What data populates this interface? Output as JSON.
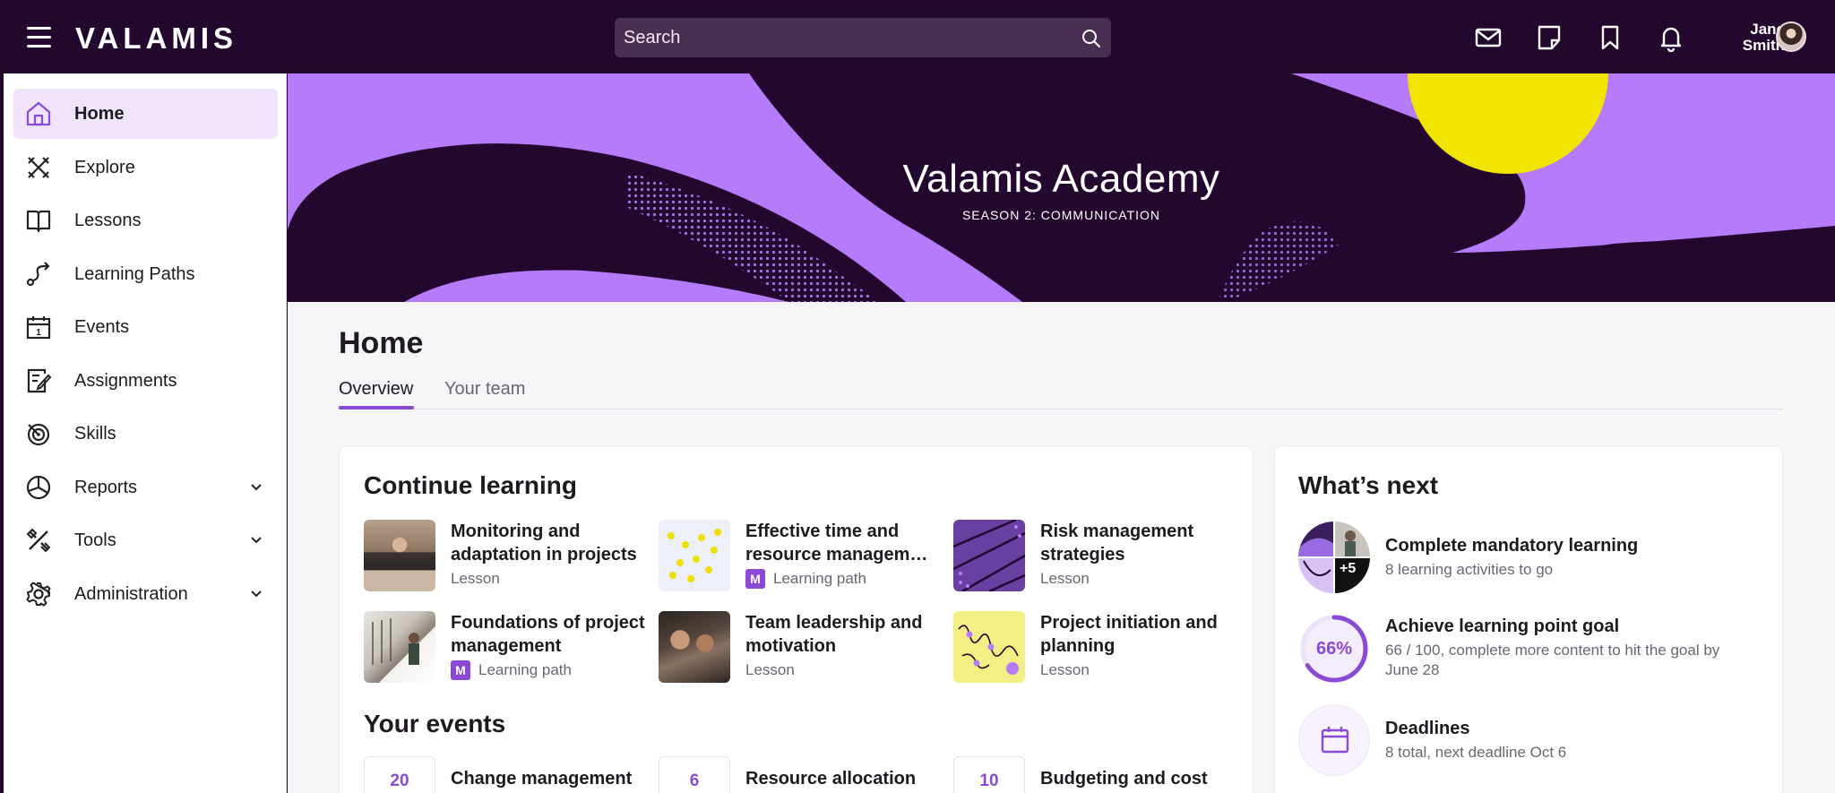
{
  "header": {
    "logo": "VALAMIS",
    "search_placeholder": "Search",
    "user_first": "Jane",
    "user_last": "Smith"
  },
  "sidebar": {
    "items": [
      {
        "label": "Home",
        "icon": "home-icon",
        "active": true
      },
      {
        "label": "Explore",
        "icon": "explore-icon"
      },
      {
        "label": "Lessons",
        "icon": "book-icon"
      },
      {
        "label": "Learning Paths",
        "icon": "path-icon"
      },
      {
        "label": "Events",
        "icon": "calendar-icon"
      },
      {
        "label": "Assignments",
        "icon": "assignment-icon"
      },
      {
        "label": "Skills",
        "icon": "target-icon"
      },
      {
        "label": "Reports",
        "icon": "pie-chart-icon",
        "expandable": true
      },
      {
        "label": "Tools",
        "icon": "tools-icon",
        "expandable": true
      },
      {
        "label": "Administration",
        "icon": "gear-icon",
        "expandable": true
      }
    ]
  },
  "banner": {
    "title": "Valamis Academy",
    "subtitle": "SEASON 2: COMMUNICATION"
  },
  "page": {
    "title": "Home",
    "tabs": [
      "Overview",
      "Your team"
    ]
  },
  "continue_learning": {
    "title": "Continue learning",
    "items": [
      {
        "title": "Monitoring and adaptation in projects",
        "type": "Lesson"
      },
      {
        "title": "Effective time and resource managem…",
        "type": "Learning path"
      },
      {
        "title": "Risk management strategies",
        "type": "Lesson"
      },
      {
        "title": "Foundations of project management",
        "type": "Learning path"
      },
      {
        "title": "Team leadership and motivation",
        "type": "Lesson"
      },
      {
        "title": "Project initiation and planning",
        "type": "Lesson"
      }
    ],
    "badge_letter": "M"
  },
  "events": {
    "title": "Your events",
    "items": [
      {
        "date": "20",
        "title": "Change management"
      },
      {
        "date": "6",
        "title": "Resource allocation"
      },
      {
        "date": "10",
        "title": "Budgeting and cost"
      }
    ]
  },
  "whats_next": {
    "title": "What’s next",
    "items": [
      {
        "title": "Complete mandatory learning",
        "desc": "8 learning activities to go",
        "extra": "+5"
      },
      {
        "title": "Achieve learning point goal",
        "desc": "66 / 100, complete more content to hit the goal by June 28",
        "percent": "66%",
        "progress": 0.66
      },
      {
        "title": "Deadlines",
        "desc": "8 total, next deadline Oct 6"
      }
    ]
  },
  "colors": {
    "accent": "#8a4ad6",
    "header_bg": "#24072f",
    "banner_purple": "#b57bfa",
    "sun_yellow": "#f0e400"
  }
}
